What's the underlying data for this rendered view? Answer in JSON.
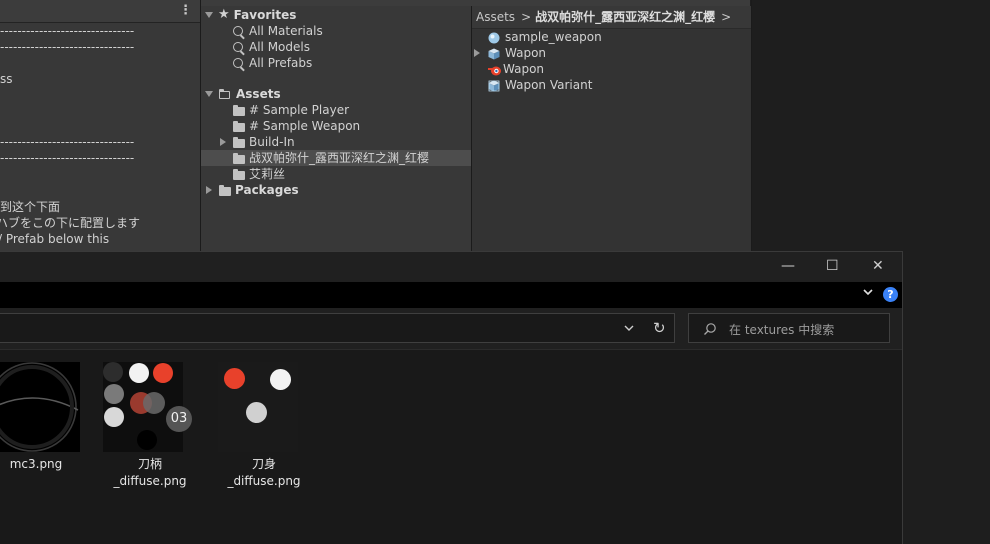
{
  "inspector": {
    "menu_icon": "kebab-menu-icon",
    "dashed_line": "-------------------------------",
    "text_ss": "ss",
    "text_cn": "到这个下面",
    "text_jp": "ハブをこの下に配置します",
    "text_en": "/ Prefab below this"
  },
  "project": {
    "favorites": {
      "label": "Favorites",
      "items": [
        "All Materials",
        "All Models",
        "All Prefabs"
      ]
    },
    "assets": {
      "label": "Assets",
      "folders": [
        "# Sample Player",
        "# Sample Weapon",
        "Build-In",
        "战双帕弥什_露西亚深红之渊_红樱",
        "艾莉丝"
      ]
    },
    "packages": {
      "label": "Packages"
    },
    "breadcrumb": {
      "root": "Assets",
      "sep": ">",
      "current": "战双帕弥什_露西亚深红之渊_红樱"
    },
    "files": [
      "sample_weapon",
      "Wapon",
      "Wapon",
      "Wapon Variant"
    ]
  },
  "explorer": {
    "minimize": "—",
    "maximize": "☐",
    "close": "✕",
    "chevron": "⌄",
    "help": "?",
    "refresh": "↻",
    "search_placeholder": "在 textures 中搜索",
    "files": [
      {
        "name_line1": "mc3.png",
        "name_line2": ""
      },
      {
        "name_line1": "刀柄",
        "name_line2": "_diffuse.png",
        "badge": "03"
      },
      {
        "name_line1": "刀身",
        "name_line2": "_diffuse.png"
      }
    ],
    "colors": {
      "accent": "#3a82f7",
      "red": "#e8412b"
    }
  }
}
